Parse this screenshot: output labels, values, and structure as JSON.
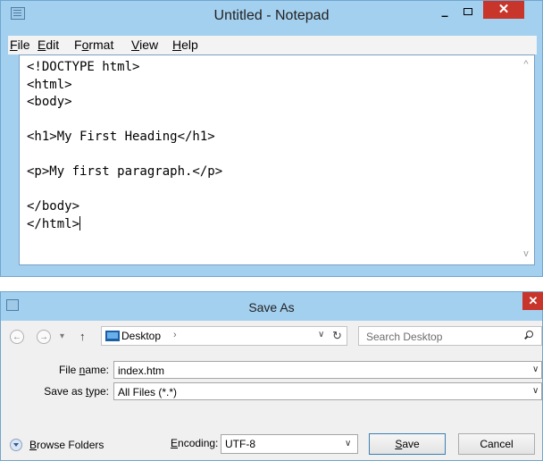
{
  "notepad": {
    "title": "Untitled - Notepad",
    "minimize": "–",
    "close": "✕",
    "menu": [
      {
        "key": "F",
        "rest": "ile"
      },
      {
        "key": "E",
        "rest": "dit"
      },
      {
        "key": "",
        "pre": "F",
        "keymid": "o",
        "rest": "rmat"
      },
      {
        "key": "V",
        "rest": "iew"
      },
      {
        "key": "H",
        "rest": "elp"
      }
    ],
    "content": "<!DOCTYPE html>\n<html>\n<body>\n\n<h1>My First Heading</h1>\n\n<p>My first paragraph.</p>\n\n</body>\n</html>",
    "scroll_up": "^",
    "scroll_down": "v"
  },
  "save_as": {
    "title": "Save As",
    "close": "✕",
    "nav": {
      "back": "←",
      "forward": "→",
      "history": "▾",
      "up": "↑"
    },
    "breadcrumb": {
      "location": "Desktop",
      "arrow": "›",
      "dropdown": "∨",
      "refresh": "↻"
    },
    "search_placeholder": "Search Desktop",
    "file_name_label": {
      "key": "n",
      "pre": "File ",
      "rest": "ame:"
    },
    "file_name_value": "index.htm",
    "save_type_label": {
      "pre": "Save as ",
      "key": "t",
      "rest": "ype:"
    },
    "save_type_value": "All Files  (*.*)",
    "dropdown_arrow": "∨",
    "browse_folders": {
      "key": "B",
      "rest": "rowse Folders"
    },
    "encoding_label": {
      "key": "E",
      "rest": "ncoding:"
    },
    "encoding_value": "UTF-8",
    "save_button": {
      "key": "S",
      "rest": "ave"
    },
    "cancel_button": "Cancel"
  }
}
